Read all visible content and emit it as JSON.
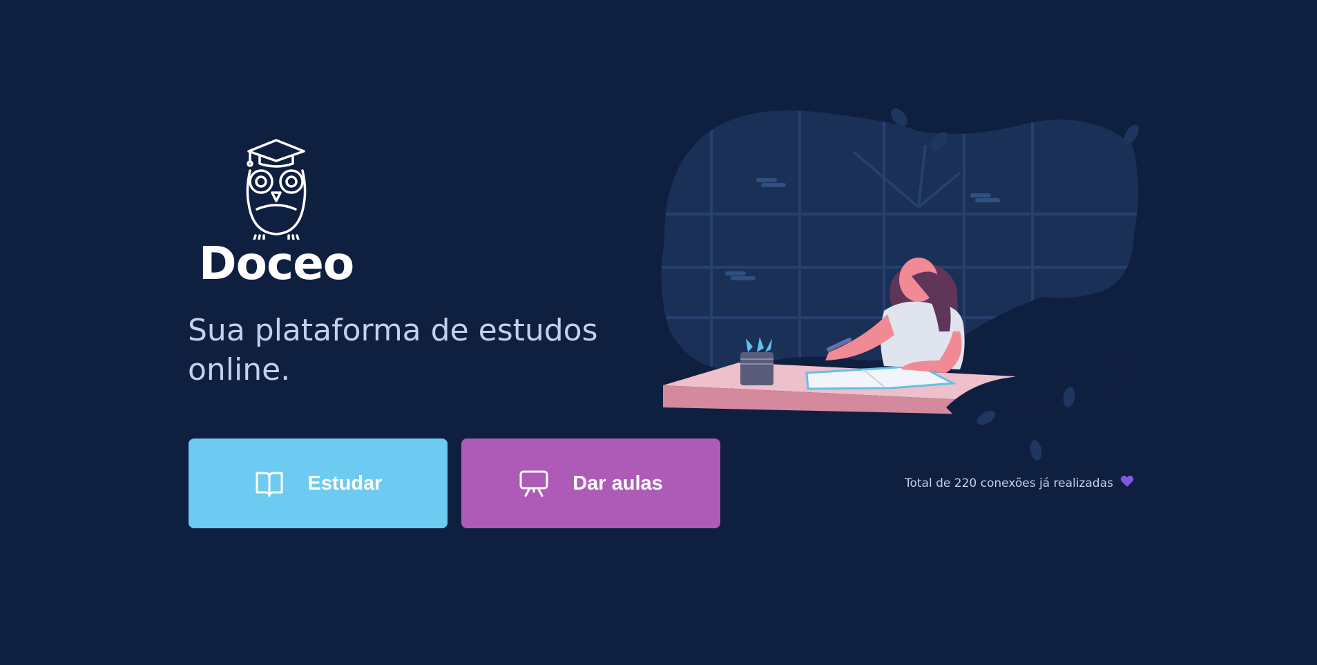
{
  "brand": {
    "name": "Doceo",
    "tagline": "Sua plataforma de estudos online."
  },
  "actions": {
    "study_label": "Estudar",
    "teach_label": "Dar aulas"
  },
  "footer": {
    "connections_text": "Total de 220 conexões já realizadas"
  },
  "icons": {
    "logo": "owl-graduate-icon",
    "study": "open-book-icon",
    "teach": "presentation-board-icon",
    "heart": "purple-heart-icon"
  },
  "colors": {
    "background": "#0f1f40",
    "study_button": "#6dcbf2",
    "teach_button": "#ae5bb8",
    "tagline_text": "#c4d1ee",
    "heart": "#8257e5"
  }
}
